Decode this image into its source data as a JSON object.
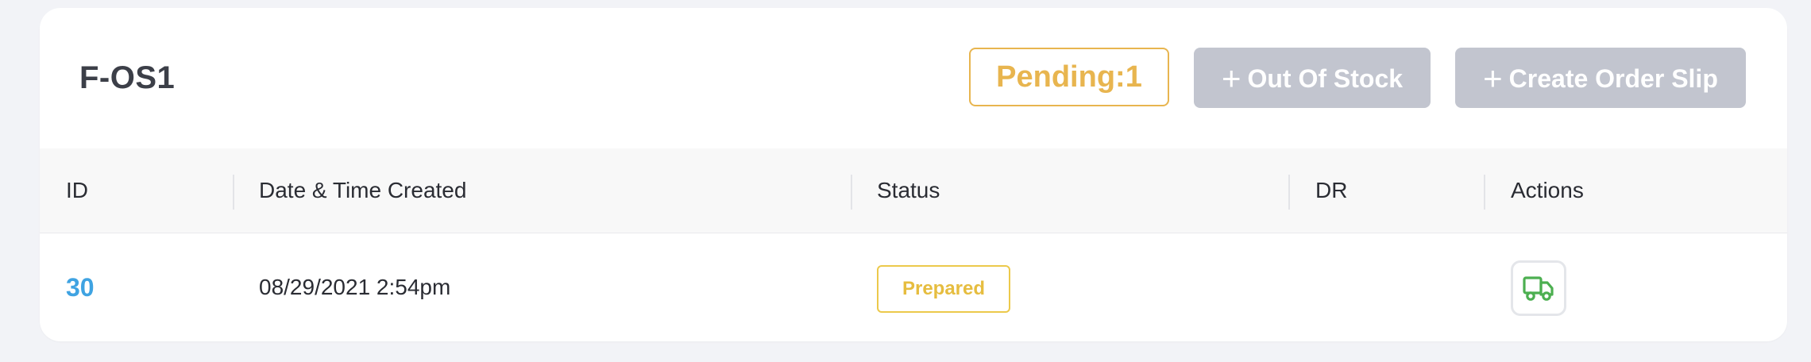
{
  "header": {
    "title": "F-OS1",
    "pending_label": "Pending:1",
    "out_of_stock_label": "Out Of Stock",
    "create_order_slip_label": "Create Order Slip",
    "plus_glyph": "+"
  },
  "table": {
    "columns": [
      "ID",
      "Date & Time Created",
      "Status",
      "DR",
      "Actions"
    ],
    "rows": [
      {
        "id": "30",
        "created": "08/29/2021 2:54pm",
        "status": "Prepared",
        "dr": "",
        "action_icon": "truck-icon"
      }
    ]
  },
  "colors": {
    "pending": "#e8b54f",
    "button_disabled": "#c2c5cf",
    "id_link": "#3fa3e2",
    "status_prepared": "#e6bd3f",
    "truck_icon": "#4caf50"
  }
}
